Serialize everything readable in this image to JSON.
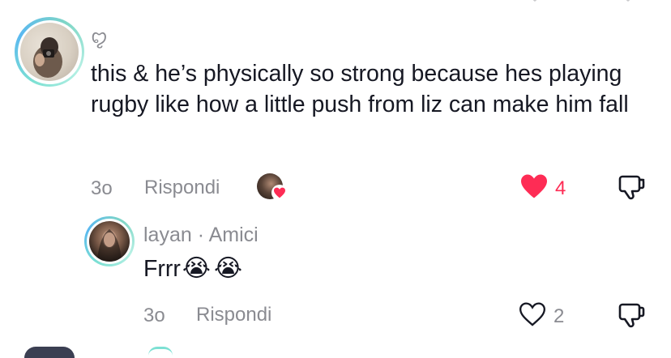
{
  "comment": {
    "username_glyph": "ꨄ",
    "text": "this & he’s physically so strong because hes playing rugby like how a little push from liz can make him fall",
    "time": "3o",
    "reply_label": "Rispondi",
    "like_count": "4",
    "like_color": "#fe2c55",
    "liked": true
  },
  "reply": {
    "username": "layan",
    "separator": " · ",
    "relation": "Amici",
    "text": "Frrr",
    "emojis": [
      "😭",
      "😭"
    ],
    "time": "3o",
    "reply_label": "Rispondi",
    "like_count": "2",
    "liked": false
  },
  "icons": {
    "like": "heart-icon",
    "dislike": "thumbs-down-icon",
    "creator_liked": "creator-liked-badge-icon"
  }
}
